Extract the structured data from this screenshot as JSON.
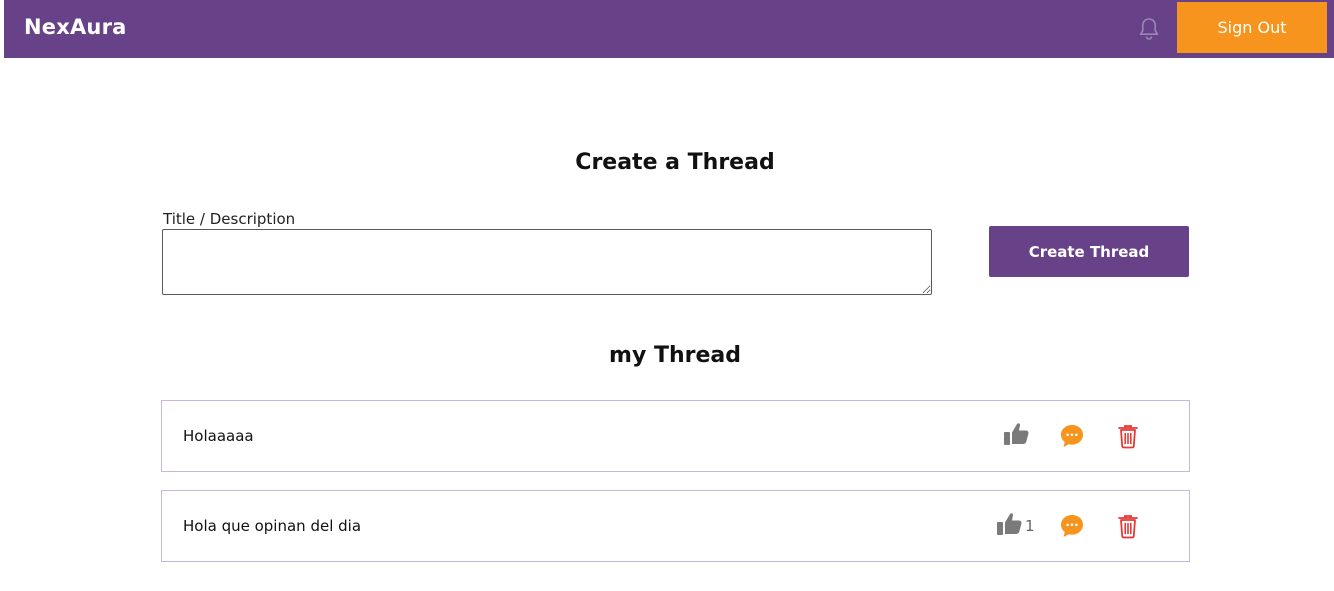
{
  "header": {
    "brand": "NexAura",
    "signout_label": "Sign Out"
  },
  "create": {
    "title": "Create a Thread",
    "field_label": "Title / Description",
    "field_value": "",
    "button_label": "Create Thread"
  },
  "threads": {
    "title": "my Thread",
    "items": [
      {
        "text": "Holaaaaa",
        "likes": ""
      },
      {
        "text": "Hola que opinan del dia",
        "likes": "1"
      }
    ]
  },
  "icons": {
    "bell": "bell-icon",
    "like": "thumbs-up-icon",
    "comment": "comment-bubble-icon",
    "delete": "trash-icon"
  },
  "colors": {
    "header_bg": "#684289",
    "accent_orange": "#f7941d",
    "primary_button": "#684289",
    "row_border": "#c7b6dd",
    "delete_red": "#e53935",
    "like_gray": "#7a7a7a"
  }
}
